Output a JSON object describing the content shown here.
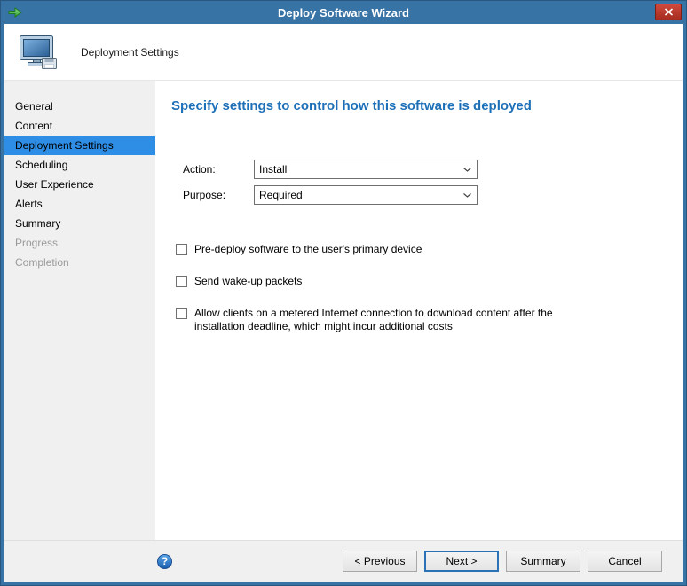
{
  "window": {
    "title": "Deploy Software Wizard"
  },
  "header": {
    "title": "Deployment Settings"
  },
  "sidebar": {
    "items": [
      {
        "label": "General",
        "state": "normal"
      },
      {
        "label": "Content",
        "state": "normal"
      },
      {
        "label": "Deployment Settings",
        "state": "selected"
      },
      {
        "label": "Scheduling",
        "state": "normal"
      },
      {
        "label": "User Experience",
        "state": "normal"
      },
      {
        "label": "Alerts",
        "state": "normal"
      },
      {
        "label": "Summary",
        "state": "normal"
      },
      {
        "label": "Progress",
        "state": "disabled"
      },
      {
        "label": "Completion",
        "state": "disabled"
      }
    ]
  },
  "main": {
    "heading": "Specify settings to control how this software is deployed",
    "action": {
      "label": "Action:",
      "value": "Install"
    },
    "purpose": {
      "label": "Purpose:",
      "value": "Required"
    },
    "checkboxes": [
      {
        "label": "Pre-deploy software to the user's primary device",
        "checked": false
      },
      {
        "label": "Send wake-up packets",
        "checked": false
      },
      {
        "label": "Allow clients on a metered Internet connection to download content after the installation deadline, which might incur additional costs",
        "checked": false
      }
    ]
  },
  "footer": {
    "help_glyph": "?",
    "buttons": {
      "previous": "< Previous",
      "next": "Next >",
      "summary": "Summary",
      "cancel": "Cancel"
    },
    "accels": {
      "previous": "P",
      "next": "N",
      "summary": "S"
    }
  },
  "icons": {
    "titlebar_left": "forward-arrow-icon",
    "close": "close-icon",
    "header": "computer-software-icon",
    "dropdown": "chevron-down-icon",
    "help": "help-icon"
  },
  "colors": {
    "titlebar": "#3873a6",
    "selected_item": "#2e8de5",
    "heading": "#1d70b8",
    "close_button": "#b53327",
    "sidebar_bg": "#f0f0f0"
  }
}
